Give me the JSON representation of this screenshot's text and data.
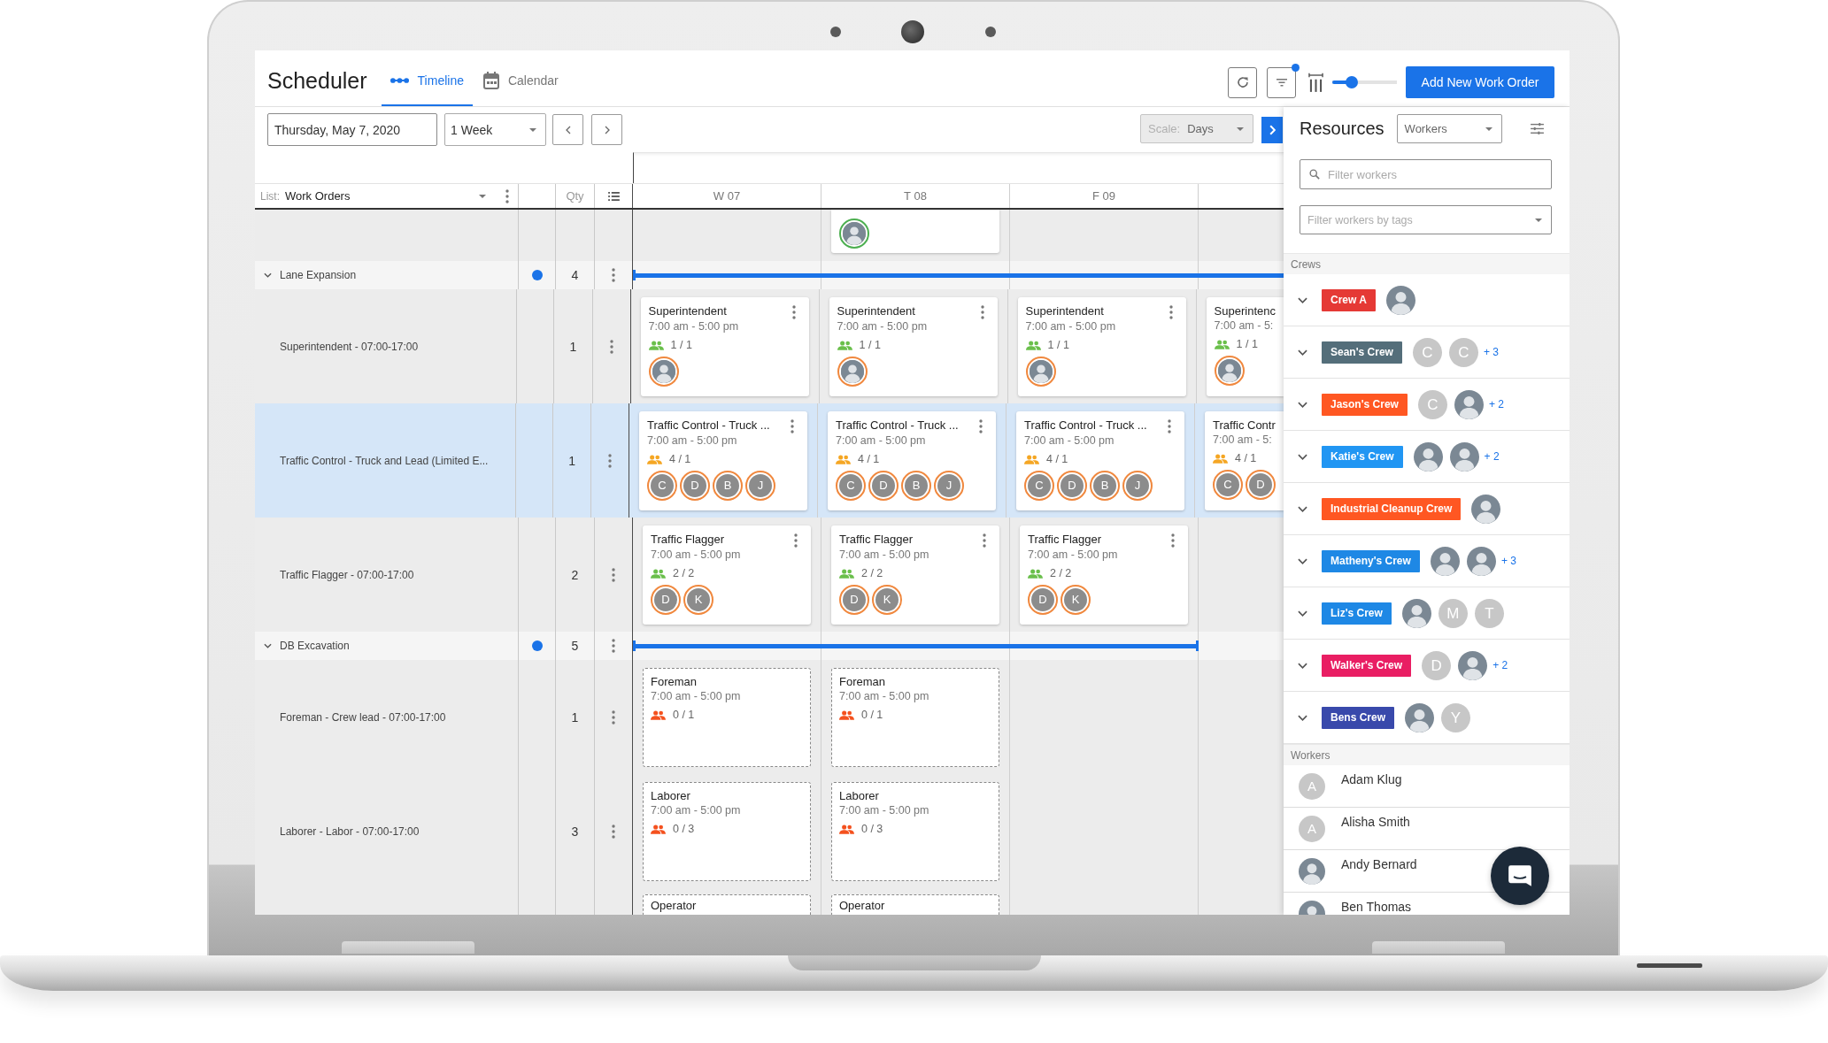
{
  "app_title": "Scheduler",
  "tabs": [
    {
      "kind": "timeline",
      "label": "Timeline",
      "selected": true
    },
    {
      "kind": "calendar",
      "label": "Calendar",
      "selected": false
    }
  ],
  "toolbar": {
    "filter_active": true,
    "zoom_slider": {
      "level": 0.3
    },
    "add_button": "Add New Work Order"
  },
  "date_field": {
    "value": "Thursday, May 7, 2020"
  },
  "range_select": {
    "value": "1 Week"
  },
  "scale_select": {
    "label": "Scale:",
    "value": "Days",
    "disabled": true
  },
  "list_header": {
    "label": "List:",
    "value": "Work Orders",
    "qty_heading": "Qty"
  },
  "days": [
    "W 07",
    "T 08",
    "F 09"
  ],
  "work_orders": [
    {
      "kind": "task",
      "selected": false,
      "cards": [
        {
          "kind": "empty"
        },
        {
          "kind": "filled",
          "avatars": [
            {
              "kind": "photo",
              "color": "#4caf50"
            }
          ]
        },
        {
          "kind": "empty"
        },
        {
          "kind": "empty"
        }
      ]
    },
    {
      "kind": "group",
      "label": "Lane Expansion",
      "qty": "4",
      "color": "#1a73e8",
      "expanded": true,
      "bar": [
        true,
        true,
        true,
        true
      ],
      "children": [
        {
          "kind": "task",
          "label": "Superintendent - 07:00-17:00",
          "qty": "1",
          "selected": false,
          "cards": [
            {
              "kind": "filled",
              "title": "Superintendent",
              "time": "7:00 am - 5:00 pm",
              "staffing": "1 / 1",
              "avatars": [
                {
                  "kind": "photo",
                  "color": "#f0883e"
                }
              ]
            },
            {
              "kind": "filled",
              "title": "Superintendent",
              "time": "7:00 am - 5:00 pm",
              "staffing": "1 / 1",
              "avatars": [
                {
                  "kind": "photo",
                  "color": "#f0883e"
                }
              ]
            },
            {
              "kind": "filled",
              "title": "Superintendent",
              "time": "7:00 am - 5:00 pm",
              "staffing": "1 / 1",
              "avatars": [
                {
                  "kind": "photo",
                  "color": "#f0883e"
                }
              ]
            },
            {
              "kind": "filled",
              "title": "Superintenc",
              "time": "7:00 am - 5:",
              "staffing": "1 / 1",
              "avatars": [
                {
                  "kind": "photo",
                  "color": "#f0883e"
                }
              ]
            }
          ]
        },
        {
          "kind": "task",
          "label": "Traffic Control - Truck and Lead (Limited E...",
          "qty": "1",
          "selected": true,
          "cards": [
            {
              "kind": "over",
              "title": "Traffic Control - Truck ...",
              "time": "7:00 am - 5:00 pm",
              "staffing": "4 / 1",
              "avatars": [
                {
                  "kind": "initial",
                  "initial": "C",
                  "color": "#f0883e"
                },
                {
                  "kind": "initial",
                  "initial": "D",
                  "color": "#f0883e"
                },
                {
                  "kind": "initial",
                  "initial": "B",
                  "color": "#f0883e"
                },
                {
                  "kind": "initial",
                  "initial": "J",
                  "color": "#f0883e"
                }
              ]
            },
            {
              "kind": "over",
              "title": "Traffic Control - Truck ...",
              "time": "7:00 am - 5:00 pm",
              "staffing": "4 / 1",
              "avatars": [
                {
                  "kind": "initial",
                  "initial": "C",
                  "color": "#f0883e"
                },
                {
                  "kind": "initial",
                  "initial": "D",
                  "color": "#f0883e"
                },
                {
                  "kind": "initial",
                  "initial": "B",
                  "color": "#f0883e"
                },
                {
                  "kind": "initial",
                  "initial": "J",
                  "color": "#f0883e"
                }
              ]
            },
            {
              "kind": "over",
              "title": "Traffic Control - Truck ...",
              "time": "7:00 am - 5:00 pm",
              "staffing": "4 / 1",
              "avatars": [
                {
                  "kind": "initial",
                  "initial": "C",
                  "color": "#f0883e"
                },
                {
                  "kind": "initial",
                  "initial": "D",
                  "color": "#f0883e"
                },
                {
                  "kind": "initial",
                  "initial": "B",
                  "color": "#f0883e"
                },
                {
                  "kind": "initial",
                  "initial": "J",
                  "color": "#f0883e"
                }
              ]
            },
            {
              "kind": "over",
              "title": "Traffic Contr",
              "time": "7:00 am - 5:",
              "staffing": "4 / 1",
              "avatars": [
                {
                  "kind": "initial",
                  "initial": "C",
                  "color": "#f0883e"
                },
                {
                  "kind": "initial",
                  "initial": "D",
                  "color": "#f0883e"
                }
              ]
            }
          ]
        },
        {
          "kind": "task",
          "label": "Traffic Flagger - 07:00-17:00",
          "qty": "2",
          "selected": false,
          "cards": [
            {
              "kind": "filled",
              "title": "Traffic Flagger",
              "time": "7:00 am - 5:00 pm",
              "staffing": "2 / 2",
              "avatars": [
                {
                  "kind": "initial",
                  "initial": "D",
                  "color": "#f0883e"
                },
                {
                  "kind": "initial",
                  "initial": "K",
                  "color": "#f0883e"
                }
              ]
            },
            {
              "kind": "filled",
              "title": "Traffic Flagger",
              "time": "7:00 am - 5:00 pm",
              "staffing": "2 / 2",
              "avatars": [
                {
                  "kind": "initial",
                  "initial": "D",
                  "color": "#f0883e"
                },
                {
                  "kind": "initial",
                  "initial": "K",
                  "color": "#f0883e"
                }
              ]
            },
            {
              "kind": "filled",
              "title": "Traffic Flagger",
              "time": "7:00 am - 5:00 pm",
              "staffing": "2 / 2",
              "avatars": [
                {
                  "kind": "initial",
                  "initial": "D",
                  "color": "#f0883e"
                },
                {
                  "kind": "initial",
                  "initial": "K",
                  "color": "#f0883e"
                }
              ]
            },
            {
              "kind": "empty"
            }
          ]
        }
      ]
    },
    {
      "kind": "group",
      "label": "DB Excavation",
      "qty": "5",
      "color": "#1a73e8",
      "expanded": true,
      "bar": [
        true,
        true,
        true,
        false
      ],
      "children": [
        {
          "kind": "task",
          "label": "Foreman - Crew lead - 07:00-17:00",
          "qty": "1",
          "selected": false,
          "cards": [
            {
              "kind": "open",
              "title": "Foreman",
              "time": "7:00 am - 5:00 pm",
              "staffing": "0 / 1"
            },
            {
              "kind": "open",
              "title": "Foreman",
              "time": "7:00 am - 5:00 pm",
              "staffing": "0 / 1"
            },
            {
              "kind": "empty"
            },
            {
              "kind": "empty"
            }
          ]
        },
        {
          "kind": "task",
          "label": "Laborer - Labor - 07:00-17:00",
          "qty": "3",
          "selected": false,
          "cards": [
            {
              "kind": "open",
              "title": "Laborer",
              "time": "7:00 am - 5:00 pm",
              "staffing": "0 / 3"
            },
            {
              "kind": "open",
              "title": "Laborer",
              "time": "7:00 am - 5:00 pm",
              "staffing": "0 / 3"
            },
            {
              "kind": "empty"
            },
            {
              "kind": "empty"
            }
          ]
        },
        {
          "kind": "task",
          "selected": false,
          "cards": [
            {
              "kind": "open",
              "title": "Operator"
            },
            {
              "kind": "open",
              "title": "Operator"
            },
            {
              "kind": "empty"
            },
            {
              "kind": "empty"
            }
          ]
        }
      ]
    }
  ],
  "resources": {
    "title": "Resources",
    "view_select": "Workers",
    "search": {
      "placeholder": "Filter workers"
    },
    "tag_filter": {
      "placeholder": "Filter workers by tags"
    },
    "crews_heading": "Crews",
    "crews": [
      {
        "name": "Crew A",
        "color": "#e53935",
        "members": [
          {
            "kind": "photo"
          }
        ]
      },
      {
        "name": "Sean's Crew",
        "color": "#546e7a",
        "members": [
          {
            "kind": "initial",
            "initial": "C"
          },
          {
            "kind": "initial",
            "initial": "C"
          }
        ],
        "more": "+ 3"
      },
      {
        "name": "Jason's Crew",
        "color": "#ff5722",
        "members": [
          {
            "kind": "initial",
            "initial": "C"
          },
          {
            "kind": "photo"
          }
        ],
        "more": "+ 2"
      },
      {
        "name": "Katie's Crew",
        "color": "#2196f3",
        "members": [
          {
            "kind": "photo"
          },
          {
            "kind": "photo"
          }
        ],
        "more": "+ 2"
      },
      {
        "name": "Industrial Cleanup Crew",
        "color": "#ff5722",
        "members": [
          {
            "kind": "photo"
          }
        ]
      },
      {
        "name": "Matheny's Crew",
        "color": "#1e88e5",
        "members": [
          {
            "kind": "photo"
          },
          {
            "kind": "photo"
          }
        ],
        "more": "+ 3"
      },
      {
        "name": "Liz's Crew",
        "color": "#1e88e5",
        "members": [
          {
            "kind": "photo"
          },
          {
            "kind": "initial",
            "initial": "M"
          },
          {
            "kind": "initial",
            "initial": "T"
          }
        ]
      },
      {
        "name": "Walker's Crew",
        "color": "#e91e63",
        "members": [
          {
            "kind": "initial",
            "initial": "D"
          },
          {
            "kind": "photo"
          }
        ],
        "more": "+ 2"
      },
      {
        "name": "Bens Crew",
        "color": "#3949ab",
        "members": [
          {
            "kind": "photo"
          },
          {
            "kind": "initial",
            "initial": "Y"
          }
        ]
      }
    ],
    "workers_heading": "Workers",
    "workers": [
      {
        "name": "Adam Klug",
        "avatar": {
          "kind": "initial",
          "initial": "A"
        }
      },
      {
        "name": "Alisha Smith",
        "avatar": {
          "kind": "initial",
          "initial": "A"
        }
      },
      {
        "name": "Andy Bernard",
        "avatar": {
          "kind": "photo"
        }
      },
      {
        "name": "Ben Thomas",
        "avatar": {
          "kind": "photo"
        }
      }
    ]
  }
}
